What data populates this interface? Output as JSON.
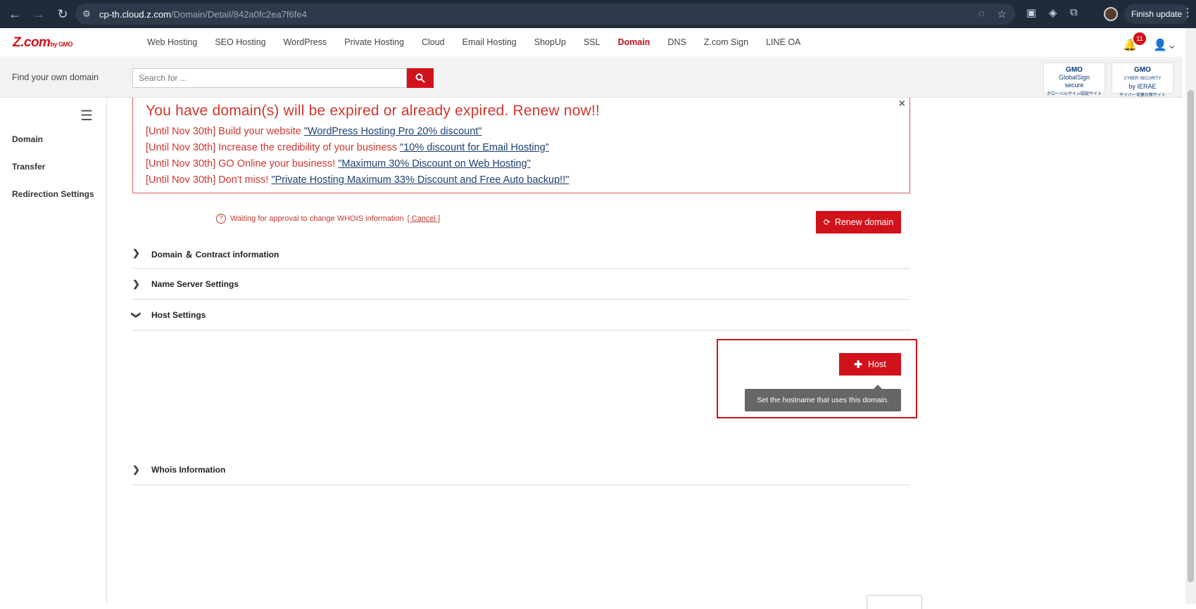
{
  "browser": {
    "url_host": "cp-th.cloud.z.com",
    "url_path": "/Domain/Detail/842a0fc2ea7f6fe4",
    "finish_update": "Finish update"
  },
  "header": {
    "logo_main": "Z.com",
    "logo_sub": "by GMO",
    "nav": [
      "Web Hosting",
      "SEO Hosting",
      "WordPress",
      "Private Hosting",
      "Cloud",
      "Email Hosting",
      "ShopUp",
      "SSL",
      "Domain",
      "DNS",
      "Z.com Sign",
      "LINE OA"
    ],
    "active_nav": "Domain",
    "notification_count": "11"
  },
  "search": {
    "label": "Find your own domain",
    "placeholder": "Search for ..."
  },
  "seals": {
    "globalsign": [
      "GMO",
      "GlobalSign",
      "secure",
      "グローバルサイン認証サイト"
    ],
    "ierae": [
      "GMO",
      "CYBER SECURITY",
      "by IERAE",
      "サイバー攻撃対策サイト"
    ]
  },
  "sidebar": {
    "items": [
      "Domain",
      "Transfer",
      "Redirection Settings"
    ]
  },
  "alert": {
    "title": "You have domain(s) will be expired or already expired. Renew now!!",
    "lines": [
      {
        "prefix": "[Until Nov 30th] Build your website ",
        "link": "\"WordPress Hosting Pro 20% discount\""
      },
      {
        "prefix": "[Until Nov 30th] Increase the credibility of your business ",
        "link": "\"10% discount for Email Hosting\""
      },
      {
        "prefix": "[Until Nov 30th] GO Online your business! ",
        "link": "\"Maximum 30% Discount on Web Hosting\""
      },
      {
        "prefix": "[Until Nov 30th] Don't miss! ",
        "link": "\"Private Hosting Maximum 33% Discount and Free Auto backup!!\""
      }
    ],
    "close": "×"
  },
  "whois_notice": {
    "text": "Waiting for approval to change WHOIS information",
    "cancel": "[ Cancel ]"
  },
  "buttons": {
    "renew": "Renew domain",
    "host": "Host"
  },
  "sections": [
    {
      "title": "Domain ＆ Contract information",
      "expanded": false
    },
    {
      "title": "Name Server Settings",
      "expanded": false
    },
    {
      "title": "Host Settings",
      "expanded": true
    },
    {
      "title": "Whois Information",
      "expanded": false
    }
  ],
  "host_tooltip": "Set the hostname that uses this domain.",
  "colors": {
    "brand_red": "#d0121b",
    "alert_red": "#d0372f",
    "link_blue": "#1d3f72"
  }
}
